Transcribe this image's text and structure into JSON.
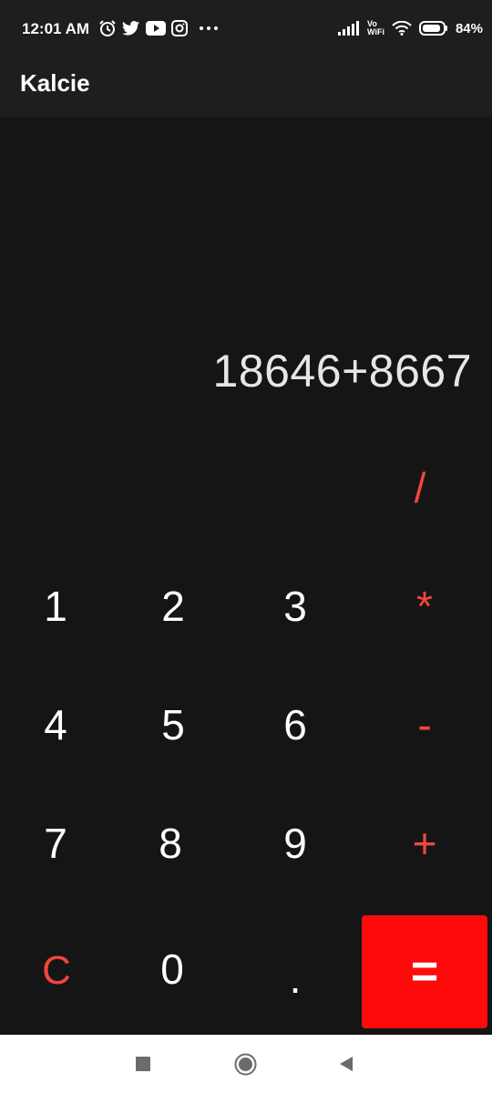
{
  "status_bar": {
    "time": "12:01 AM",
    "left_icons": [
      "alarm-icon",
      "twitter-icon",
      "youtube-icon",
      "instagram-icon",
      "more-dots-icon"
    ],
    "right_icons": [
      "signal-icon",
      "vowifi-icon",
      "wifi-icon",
      "battery-icon"
    ],
    "vowifi_label_top": "Vo",
    "vowifi_label_bottom": "WiFi",
    "battery": "84%"
  },
  "app_bar": {
    "title": "Kalcie"
  },
  "display": {
    "expression": "18646+8667"
  },
  "keys": {
    "divide": "/",
    "multiply": "*",
    "subtract": "-",
    "add": "+",
    "one": "1",
    "two": "2",
    "three": "3",
    "four": "4",
    "five": "5",
    "six": "6",
    "seven": "7",
    "eight": "8",
    "nine": "9",
    "clear": "C",
    "zero": "0",
    "decimal": ".",
    "equals": "="
  },
  "nav_bar": {
    "icons": [
      "recents-square-icon",
      "home-circle-icon",
      "back-triangle-icon"
    ]
  },
  "colors": {
    "background": "#151515",
    "bar": "#1e1e1e",
    "operator": "#f0463e",
    "equals_button": "#ff0a0a"
  }
}
